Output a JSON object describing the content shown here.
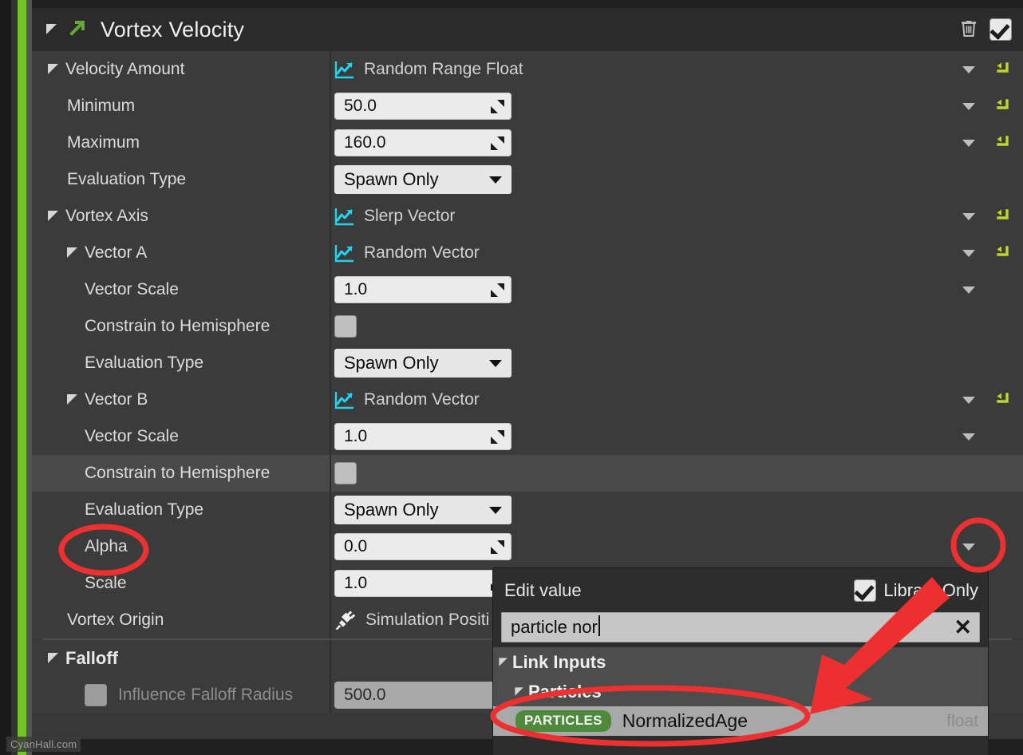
{
  "header": {
    "title": "Vortex Velocity",
    "collapse_icon": "triangle-collapse-icon",
    "module_icon": "green-arrow-icon",
    "delete_icon": "trash-icon",
    "enabled_checkbox": "checked"
  },
  "rows": [
    {
      "label": "Velocity Amount",
      "indent": 0,
      "type": "dynamic",
      "value": "Random Range Float",
      "icon": "chart-icon",
      "dropdown": true,
      "reset": true,
      "alt": false
    },
    {
      "label": "Minimum",
      "indent": 1,
      "type": "number",
      "value": "50.0",
      "dropdown": true,
      "reset": true,
      "alt": false
    },
    {
      "label": "Maximum",
      "indent": 1,
      "type": "number",
      "value": "160.0",
      "dropdown": true,
      "reset": true,
      "alt": false
    },
    {
      "label": "Evaluation Type",
      "indent": 1,
      "type": "combo",
      "value": "Spawn Only",
      "dropdown": false,
      "reset": false,
      "alt": false
    },
    {
      "label": "Vortex Axis",
      "indent": 0,
      "type": "dynamic",
      "value": "Slerp Vector",
      "icon": "chart-icon",
      "dropdown": true,
      "reset": true,
      "alt": false
    },
    {
      "label": "Vector A",
      "indent": 1,
      "type": "dynamic",
      "value": "Random Vector",
      "icon": "chart-icon",
      "dropdown": true,
      "reset": true,
      "alt": false
    },
    {
      "label": "Vector Scale",
      "indent": 2,
      "type": "number",
      "value": "1.0",
      "dropdown": true,
      "reset": false,
      "alt": false
    },
    {
      "label": "Constrain to Hemisphere",
      "indent": 2,
      "type": "checkbox",
      "value": "unchecked",
      "dropdown": false,
      "reset": false,
      "alt": false
    },
    {
      "label": "Evaluation Type",
      "indent": 2,
      "type": "combo",
      "value": "Spawn Only",
      "dropdown": false,
      "reset": false,
      "alt": false
    },
    {
      "label": "Vector B",
      "indent": 1,
      "type": "dynamic",
      "value": "Random Vector",
      "icon": "chart-icon",
      "dropdown": true,
      "reset": true,
      "alt": false
    },
    {
      "label": "Vector Scale",
      "indent": 2,
      "type": "number",
      "value": "1.0",
      "dropdown": true,
      "reset": false,
      "alt": false
    },
    {
      "label": "Constrain to Hemisphere",
      "indent": 2,
      "type": "checkbox",
      "value": "unchecked",
      "dropdown": false,
      "reset": false,
      "alt": true
    },
    {
      "label": "Evaluation Type",
      "indent": 2,
      "type": "combo",
      "value": "Spawn Only",
      "dropdown": false,
      "reset": false,
      "alt": false
    },
    {
      "label": "Alpha",
      "indent": 2,
      "type": "number",
      "value": "0.0",
      "dropdown": true,
      "reset": false,
      "alt": false
    },
    {
      "label": "Scale",
      "indent": 2,
      "type": "number",
      "value": "1.0",
      "dropdown": false,
      "reset": false,
      "alt": false
    },
    {
      "label": "Vortex Origin",
      "indent": 1,
      "type": "dynamic",
      "value": "Simulation Positi",
      "icon": "plug-icon",
      "dropdown": false,
      "reset": false,
      "alt": false
    }
  ],
  "falloff": {
    "header_label": "Falloff",
    "row_label": "Influence Falloff Radius",
    "row_value": "500.0",
    "row_checkbox": "unchecked"
  },
  "popup": {
    "title": "Edit value",
    "library_only_label": "Library Only",
    "library_only_checked": "checked",
    "search_value": "particle nor",
    "clear_icon": "close-icon",
    "tree": [
      {
        "label": "Link Inputs",
        "indent": 0
      },
      {
        "label": "Particles",
        "indent": 1
      }
    ],
    "entry": {
      "badge": "PARTICLES",
      "name": "NormalizedAge",
      "type": "float"
    }
  },
  "annotations": {
    "highlight_color": "#ef3030",
    "accent_green": "#73c522",
    "reset_arrow_color": "#bfd62f"
  },
  "watermark": "CyanHall.com"
}
